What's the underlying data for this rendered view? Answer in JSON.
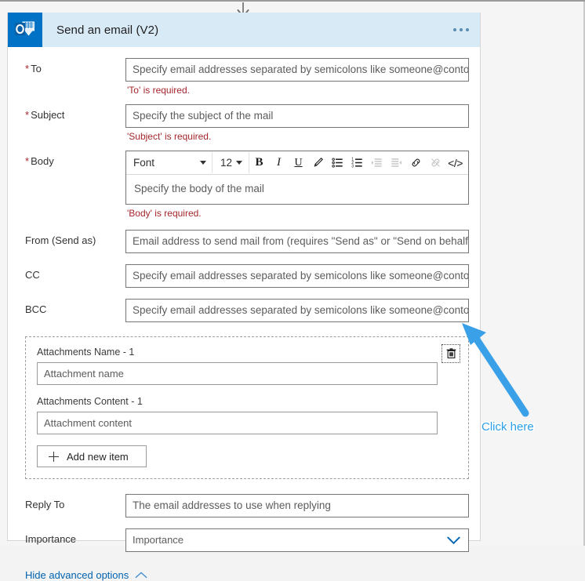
{
  "card": {
    "title": "Send an email (V2)",
    "icon": "outlook-icon",
    "overflow_menu": "…"
  },
  "fields": {
    "to": {
      "label": "To",
      "required": true,
      "placeholder": "Specify email addresses separated by semicolons like someone@contoso.com",
      "error": "'To' is required."
    },
    "subject": {
      "label": "Subject",
      "required": true,
      "placeholder": "Specify the subject of the mail",
      "error": "'Subject' is required."
    },
    "body": {
      "label": "Body",
      "required": true,
      "placeholder": "Specify the body of the mail",
      "error": "'Body' is required."
    },
    "from": {
      "label": "From (Send as)",
      "required": false,
      "placeholder": "Email address to send mail from (requires \"Send as\" or \"Send on behalf of\" permissions)"
    },
    "cc": {
      "label": "CC",
      "required": false,
      "placeholder": "Specify email addresses separated by semicolons like someone@contoso.com"
    },
    "bcc": {
      "label": "BCC",
      "required": false,
      "placeholder": "Specify email addresses separated by semicolons like someone@contoso.com"
    },
    "reply_to": {
      "label": "Reply To",
      "required": false,
      "placeholder": "The email addresses to use when replying"
    },
    "importance": {
      "label": "Importance",
      "required": false,
      "placeholder": "Importance"
    }
  },
  "rich_text_toolbar": {
    "font_name": "Font",
    "font_size": "12",
    "buttons": [
      {
        "name": "bold-button",
        "glyph": "B",
        "disabled": false
      },
      {
        "name": "italic-button",
        "glyph": "I",
        "disabled": false
      },
      {
        "name": "underline-button",
        "glyph": "U",
        "disabled": false
      },
      {
        "name": "text-color-button",
        "glyph": "pen-icon",
        "disabled": false
      },
      {
        "name": "bulleted-list-button",
        "glyph": "bullet-list-icon",
        "disabled": false
      },
      {
        "name": "numbered-list-button",
        "glyph": "numbered-list-icon",
        "disabled": false
      },
      {
        "name": "indent-button",
        "glyph": "indent-icon",
        "disabled": true
      },
      {
        "name": "outdent-button",
        "glyph": "outdent-icon",
        "disabled": true
      },
      {
        "name": "link-button",
        "glyph": "link-icon",
        "disabled": false
      },
      {
        "name": "unlink-button",
        "glyph": "unlink-icon",
        "disabled": true
      },
      {
        "name": "code-view-button",
        "glyph": "</>",
        "disabled": false
      }
    ]
  },
  "attachments": {
    "name_label": "Attachments Name - 1",
    "name_placeholder": "Attachment name",
    "content_label": "Attachments Content - 1",
    "content_placeholder": "Attachment content",
    "add_button": "Add new item",
    "delete_icon": "trash-icon"
  },
  "advanced": {
    "label": "Hide advanced options",
    "chevron": "chevron-up-icon"
  },
  "annotation": {
    "text": "Click here",
    "color": "#2b9fe8"
  },
  "colors": {
    "header_bg": "#d9eaf7",
    "icon_bg": "#0072c6",
    "error": "#a4262c",
    "link": "#0063b1",
    "accent": "#2b9fe8"
  }
}
